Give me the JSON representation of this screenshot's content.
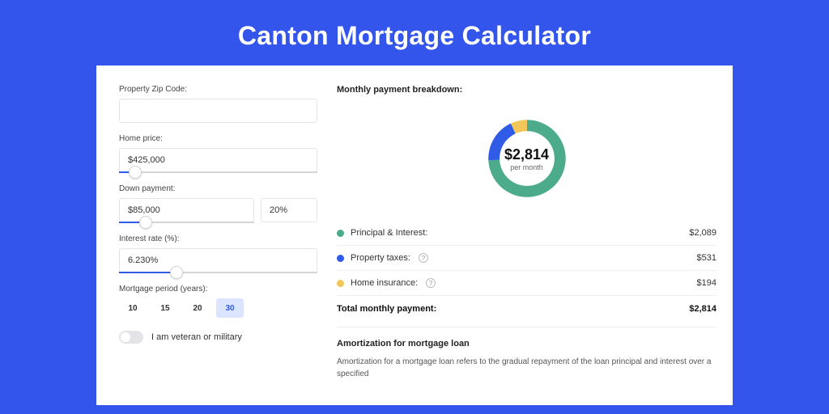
{
  "title": "Canton Mortgage Calculator",
  "colors": {
    "green": "#4bab8a",
    "blue": "#2f5be7",
    "yellow": "#f3c659"
  },
  "form": {
    "zip_label": "Property Zip Code:",
    "zip_value": "",
    "price_label": "Home price:",
    "price_value": "$425,000",
    "price_slider_pct": 8,
    "down_label": "Down payment:",
    "down_value": "$85,000",
    "down_pct_value": "20%",
    "down_slider_pct": 20,
    "rate_label": "Interest rate (%):",
    "rate_value": "6.230%",
    "rate_slider_pct": 29,
    "period_label": "Mortgage period (years):",
    "period_options": [
      "10",
      "15",
      "20",
      "30"
    ],
    "period_selected": "30",
    "veteran_label": "I am veteran or military"
  },
  "breakdown": {
    "title": "Monthly payment breakdown:",
    "center_amount": "$2,814",
    "center_sub": "per month",
    "rows": [
      {
        "label": "Principal & Interest:",
        "value": "$2,089",
        "color": "#4bab8a",
        "info": false
      },
      {
        "label": "Property taxes:",
        "value": "$531",
        "color": "#2f5be7",
        "info": true
      },
      {
        "label": "Home insurance:",
        "value": "$194",
        "color": "#f3c659",
        "info": true
      }
    ],
    "total_label": "Total monthly payment:",
    "total_value": "$2,814"
  },
  "chart_data": {
    "type": "pie",
    "title": "Monthly payment breakdown",
    "series": [
      {
        "name": "Principal & Interest",
        "value": 2089,
        "color": "#4bab8a"
      },
      {
        "name": "Property taxes",
        "value": 531,
        "color": "#2f5be7"
      },
      {
        "name": "Home insurance",
        "value": 194,
        "color": "#f3c659"
      }
    ],
    "total": 2814,
    "center_label": "$2,814 per month"
  },
  "amortization": {
    "title": "Amortization for mortgage loan",
    "text": "Amortization for a mortgage loan refers to the gradual repayment of the loan principal and interest over a specified"
  }
}
